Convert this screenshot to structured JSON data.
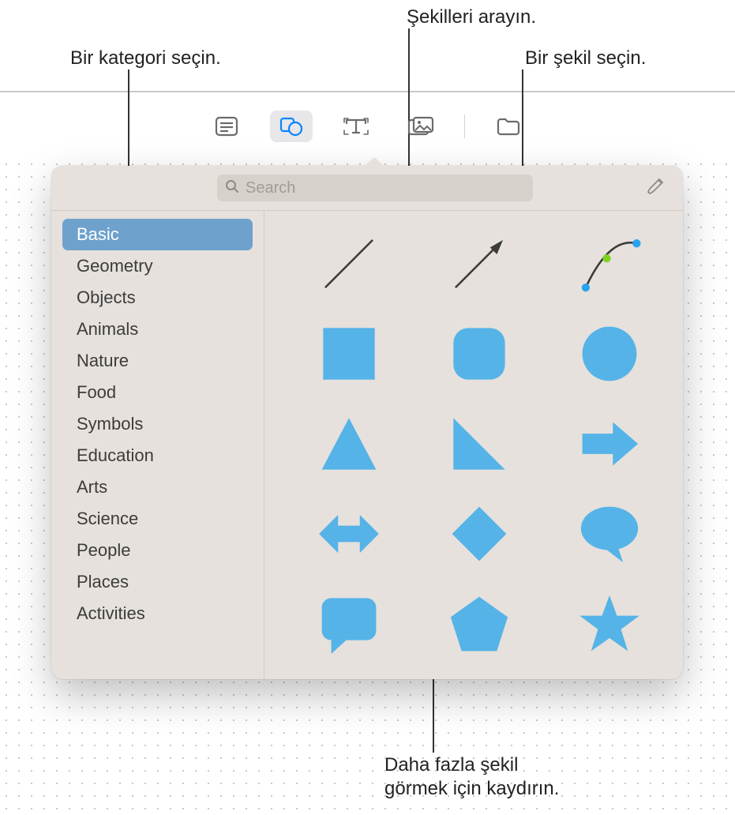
{
  "callouts": {
    "search": "Şekilleri arayın.",
    "category": "Bir kategori seçin.",
    "shape": "Bir şekil seçin.",
    "scroll_line1": "Daha fazla şekil",
    "scroll_line2": "görmek için kaydırın."
  },
  "toolbar": {
    "items": [
      "notes-icon",
      "shapes-icon",
      "text-icon",
      "media-icon",
      "folder-icon"
    ],
    "active_index": 1
  },
  "search": {
    "placeholder": "Search"
  },
  "sidebar": {
    "selected_index": 0,
    "items": [
      {
        "label": "Basic"
      },
      {
        "label": "Geometry"
      },
      {
        "label": "Objects"
      },
      {
        "label": "Animals"
      },
      {
        "label": "Nature"
      },
      {
        "label": "Food"
      },
      {
        "label": "Symbols"
      },
      {
        "label": "Education"
      },
      {
        "label": "Arts"
      },
      {
        "label": "Science"
      },
      {
        "label": "People"
      },
      {
        "label": "Places"
      },
      {
        "label": "Activities"
      }
    ]
  },
  "shapes": {
    "items": [
      {
        "name": "line"
      },
      {
        "name": "arrow-line"
      },
      {
        "name": "curve"
      },
      {
        "name": "square"
      },
      {
        "name": "rounded-square"
      },
      {
        "name": "circle"
      },
      {
        "name": "triangle"
      },
      {
        "name": "right-triangle"
      },
      {
        "name": "arrow-right"
      },
      {
        "name": "double-arrow"
      },
      {
        "name": "diamond"
      },
      {
        "name": "speech-bubble-round"
      },
      {
        "name": "speech-bubble-square"
      },
      {
        "name": "pentagon"
      },
      {
        "name": "star"
      }
    ],
    "fill_color": "#55b3e8",
    "stroke_color": "#3b3b3b"
  }
}
